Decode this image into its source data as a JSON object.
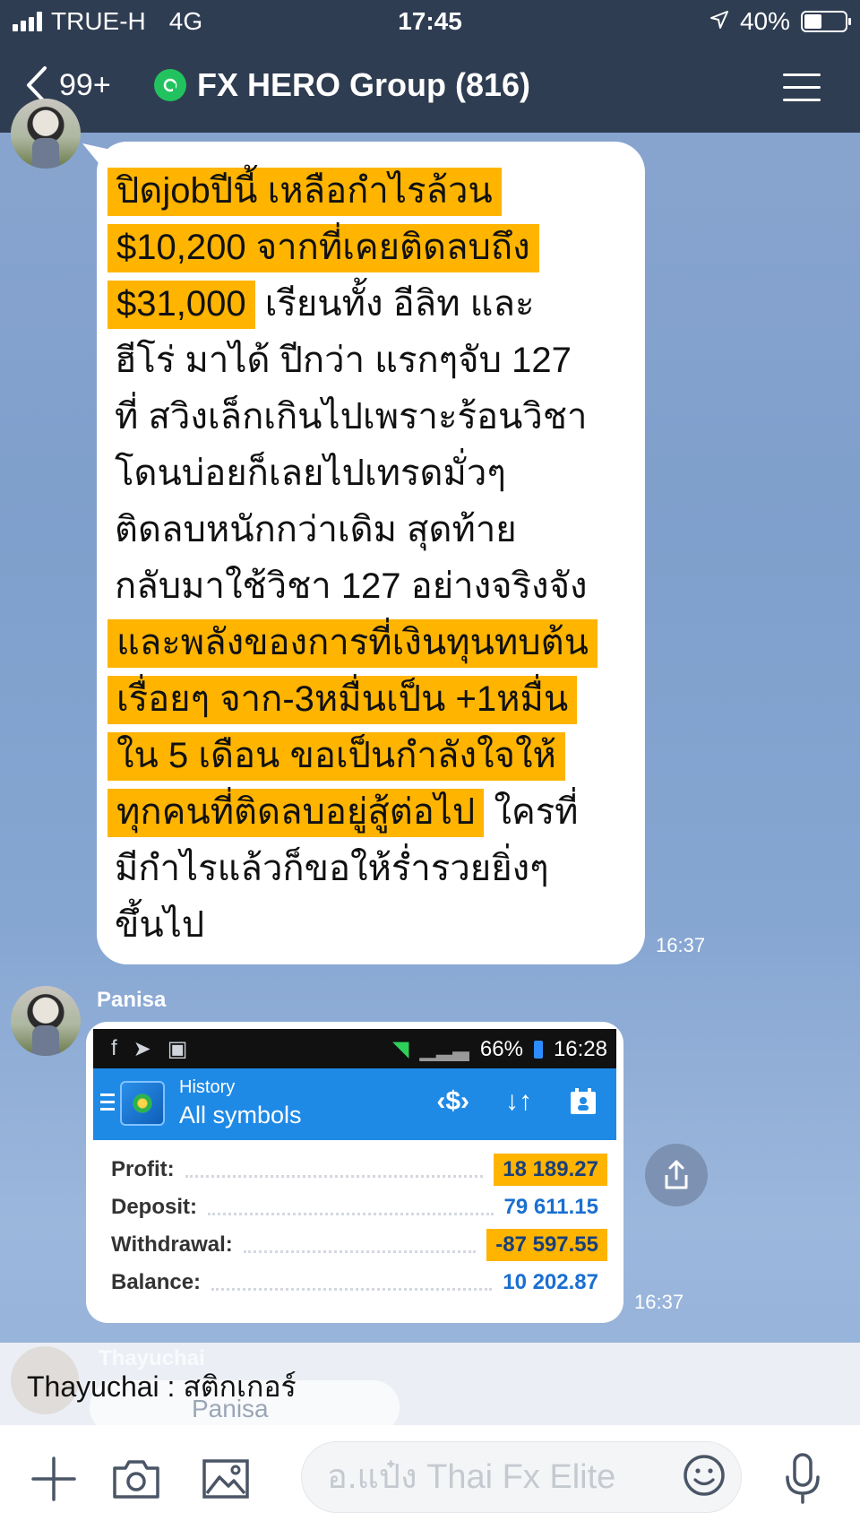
{
  "status_bar": {
    "carrier": "TRUE-H",
    "network": "4G",
    "time": "17:45",
    "battery": "40%"
  },
  "header": {
    "back_label": "99+",
    "group_title": "FX HERO Group (816)"
  },
  "messages": {
    "text_message": {
      "lines": [
        {
          "hl": "ปิดjobปีนี้ เหลือกำไรล้วน",
          "rest": ""
        },
        {
          "hl": "$10,200 จากที่เคยติดลบถึง",
          "rest": ""
        },
        {
          "hl": "$31,000",
          "rest": " เรียนทั้ง อีลิท และ"
        },
        {
          "hl": "",
          "rest": "ฮีโร่ มาได้ ปีกว่า แรกๆจับ 127"
        },
        {
          "hl": "",
          "rest": "ที่ สวิงเล็กเกินไปเพราะร้อนวิชา"
        },
        {
          "hl": "",
          "rest": "โดนบ่อยก็เลยไปเทรดมั่วๆ"
        },
        {
          "hl": "",
          "rest": "ติดลบหนักกว่าเดิม สุดท้าย"
        },
        {
          "hl": "",
          "rest": "กลับมาใช้วิชา 127 อย่างจริงจัง"
        },
        {
          "hl": "และพลังของการที่เงินทุนทบต้น",
          "rest": ""
        },
        {
          "hl": "เรื่อยๆ จาก-3หมื่นเป็น +1หมื่น",
          "rest": ""
        },
        {
          "hl": "ใน 5 เดือน  ขอเป็นกำลังใจให้",
          "rest": ""
        },
        {
          "hl": "ทุกคนที่ติดลบอยู่สู้ต่อไป",
          "rest": " ใครที่"
        },
        {
          "hl": "",
          "rest": "มีกำไรแล้วก็ขอให้ร่ำรวยยิ่งๆ"
        },
        {
          "hl": "",
          "rest": "ขึ้นไป"
        }
      ],
      "time": "16:37"
    },
    "image_message": {
      "sender": "Panisa",
      "time": "16:37",
      "screenshot": {
        "status_battery": "66%",
        "status_time": "16:28",
        "title_top": "History",
        "title_main": "All symbols",
        "rows": [
          {
            "label": "Profit:",
            "value": "18 189.27",
            "highlight": true
          },
          {
            "label": "Deposit:",
            "value": "79 611.15",
            "highlight": false
          },
          {
            "label": "Withdrawal:",
            "value": "-87 597.55",
            "highlight": true
          },
          {
            "label": "Balance:",
            "value": "10 202.87",
            "highlight": false
          }
        ]
      }
    }
  },
  "notification": {
    "faded_name": "Thayuchai",
    "text": "Thayuchai : สติกเกอร์",
    "ghost_name": "Panisa"
  },
  "input_bar": {
    "placeholder": "อ.แป๋ง Thai Fx Elite"
  },
  "colors": {
    "header_bg": "#2f3d52",
    "highlight": "#ffb400",
    "mt_blue": "#1f8ae6",
    "value_blue": "#1a6fd0"
  }
}
